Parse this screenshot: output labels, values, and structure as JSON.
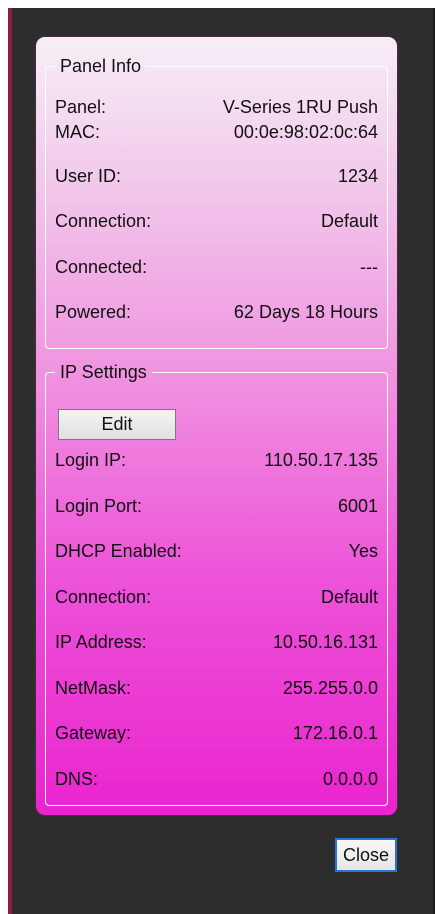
{
  "panel_info": {
    "legend": "Panel Info",
    "rows": [
      {
        "label": "Panel:",
        "value": "V-Series 1RU Push"
      },
      {
        "label": "MAC:",
        "value": "00:0e:98:02:0c:64"
      },
      {
        "label": "User ID:",
        "value": "1234"
      },
      {
        "label": "Connection:",
        "value": "Default"
      },
      {
        "label": "Connected:",
        "value": "---"
      },
      {
        "label": "Powered:",
        "value": "62 Days 18 Hours"
      }
    ]
  },
  "ip_settings": {
    "legend": "IP Settings",
    "edit_label": "Edit",
    "rows": [
      {
        "label": "Login IP:",
        "value": "110.50.17.135"
      },
      {
        "label": "Login Port:",
        "value": "6001"
      },
      {
        "label": "DHCP Enabled:",
        "value": "Yes"
      },
      {
        "label": "Connection:",
        "value": "Default"
      },
      {
        "label": "IP Address:",
        "value": "10.50.16.131"
      },
      {
        "label": "NetMask:",
        "value": "255.255.0.0"
      },
      {
        "label": "Gateway:",
        "value": "172.16.0.1"
      },
      {
        "label": "DNS:",
        "value": "0.0.0.0"
      }
    ]
  },
  "close_label": "Close"
}
